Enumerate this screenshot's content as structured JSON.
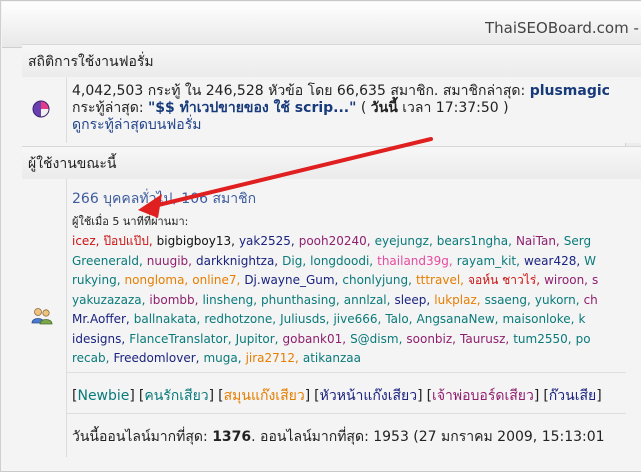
{
  "window": {
    "title": "ThaiSEOBoard.com - ค"
  },
  "stats_section": {
    "header": "สถิติการใช้งานฟอรั่ม",
    "line1_prefix": "4,042,503 กระทู้ ใน 246,528 หัวข้อ โดย 66,635 สมาชิก. สมาชิกล่าสุด: ",
    "latest_member": "plusmagic",
    "line2_prefix": "กระทู้ล่าสุด: ",
    "latest_post": "\"$$ ทำเวปขายของ ใช้ scrip...\"",
    "line2_paren_open": " ( ",
    "today_label": "วันนี้",
    "line2_time": " เวลา 17:37:50 )",
    "recent_posts_link": "ดูกระทู้ล่าสุดบนฟอรั่ม"
  },
  "online_section": {
    "header": "ผู้ใช้งานขณะนี้",
    "summary": "266 บุคคลทั่วไป, 106 สมาชิก",
    "last_minutes": "ผู้ใช้เมื่อ 5 นาทีที่ผ่านมา:",
    "user_rows": [
      [
        {
          "name": "icez,",
          "color": "#cc1111"
        },
        {
          "name": "ป๊อปแป๊ป,",
          "color": "#cc1111"
        },
        {
          "name": "bigbigboy13,",
          "color": "#111111"
        },
        {
          "name": "yak2525,",
          "color": "#1a237e"
        },
        {
          "name": "pooh20240,",
          "color": "#8e1f6e"
        },
        {
          "name": "eyejungz,",
          "color": "#0a7a7a"
        },
        {
          "name": "bears1ngha,",
          "color": "#0a7a7a"
        },
        {
          "name": "NaiTan,",
          "color": "#8e1f6e"
        },
        {
          "name": "Serg",
          "color": "#0a7a7a"
        }
      ],
      [
        {
          "name": "Greenerald,",
          "color": "#0a7a7a"
        },
        {
          "name": "nuugib,",
          "color": "#8e1f6e"
        },
        {
          "name": "darkknightza,",
          "color": "#1a237e"
        },
        {
          "name": "Dig,",
          "color": "#0a7a7a"
        },
        {
          "name": "longdoodi,",
          "color": "#0a7a7a"
        },
        {
          "name": "thailand39g,",
          "color": "#e64aa0"
        },
        {
          "name": "rayam_kit,",
          "color": "#0a7a7a"
        },
        {
          "name": "wear428,",
          "color": "#1a237e"
        },
        {
          "name": "W",
          "color": "#0a7a7a"
        }
      ],
      [
        {
          "name": "rukying,",
          "color": "#0a7a7a"
        },
        {
          "name": "nongloma,",
          "color": "#e67e00"
        },
        {
          "name": "online7,",
          "color": "#e67e00"
        },
        {
          "name": "Dj.wayne_Gum,",
          "color": "#1a237e"
        },
        {
          "name": "chonlyjung,",
          "color": "#0a7a7a"
        },
        {
          "name": "tttravel,",
          "color": "#e67e00"
        },
        {
          "name": "จอห์น ชาวไร่,",
          "color": "#cc1111"
        },
        {
          "name": "wiroon,",
          "color": "#8e1f6e"
        },
        {
          "name": "s",
          "color": "#8e1f6e"
        }
      ],
      [
        {
          "name": "yakuzazaza,",
          "color": "#0a7a7a"
        },
        {
          "name": "ibombb,",
          "color": "#8e1f6e"
        },
        {
          "name": "linsheng,",
          "color": "#0a7a7a"
        },
        {
          "name": "phunthasing,",
          "color": "#0a7a7a"
        },
        {
          "name": "annlzal,",
          "color": "#0a7a7a"
        },
        {
          "name": "sleep,",
          "color": "#1a237e"
        },
        {
          "name": "lukplaz,",
          "color": "#e67e00"
        },
        {
          "name": "ssaeng,",
          "color": "#0a7a7a"
        },
        {
          "name": "yukorn,",
          "color": "#0a7a7a"
        },
        {
          "name": "ch",
          "color": "#8e1f6e"
        }
      ],
      [
        {
          "name": "Mr.Aoffer,",
          "color": "#1a237e"
        },
        {
          "name": "ballnakata,",
          "color": "#0a7a7a"
        },
        {
          "name": "redhotzone,",
          "color": "#0a7a7a"
        },
        {
          "name": "Juliusds,",
          "color": "#0a7a7a"
        },
        {
          "name": "jive666,",
          "color": "#0a7a7a"
        },
        {
          "name": "Talo,",
          "color": "#0a7a7a"
        },
        {
          "name": "AngsanaNew,",
          "color": "#0a7a7a"
        },
        {
          "name": "maisonloke,",
          "color": "#0a7a7a"
        },
        {
          "name": "k",
          "color": "#0a7a7a"
        }
      ],
      [
        {
          "name": "idesigns,",
          "color": "#1a237e"
        },
        {
          "name": "FlanceTranslator,",
          "color": "#0a7a7a"
        },
        {
          "name": "Jupitor,",
          "color": "#0a7a7a"
        },
        {
          "name": "gobank01,",
          "color": "#8e1f6e"
        },
        {
          "name": "S@dism,",
          "color": "#0a7a7a"
        },
        {
          "name": "soonbiz,",
          "color": "#8e1f6e"
        },
        {
          "name": "Taurusz,",
          "color": "#8e1f6e"
        },
        {
          "name": "tum2550,",
          "color": "#0a7a7a"
        },
        {
          "name": "po",
          "color": "#0a7a7a"
        }
      ],
      [
        {
          "name": "recab,",
          "color": "#0a7a7a"
        },
        {
          "name": "Freedomlover,",
          "color": "#1a237e"
        },
        {
          "name": "muga,",
          "color": "#0a7a7a"
        },
        {
          "name": "jira2712,",
          "color": "#e67e00"
        },
        {
          "name": "atikanzaa",
          "color": "#0a7a7a"
        }
      ]
    ],
    "groups": [
      {
        "label": "Newbie",
        "color": "#0a7a7a"
      },
      {
        "label": "คนรักเสียว",
        "color": "#0a7a7a"
      },
      {
        "label": "สมุนแก๊งเสียว",
        "color": "#e67e00"
      },
      {
        "label": "หัวหน้าแก๊งเสียว",
        "color": "#1a237e"
      },
      {
        "label": "เจ้าพ่อบอร์ดเสียว",
        "color": "#8e1f6e"
      },
      {
        "label": "ก๊วนเสีย",
        "color": "#1a237e"
      }
    ],
    "record_prefix": "วันนี้ออนไลน์มากที่สุด: ",
    "record_today": "1376",
    "record_suffix": ". ออนไลน์มากที่สุด: 1953 (27 มกราคม 2009, 15:13:01"
  },
  "annotation": {
    "arrow_color": "#e02020"
  },
  "icons": {
    "stats": "pie-chart-icon",
    "online": "users-icon"
  }
}
